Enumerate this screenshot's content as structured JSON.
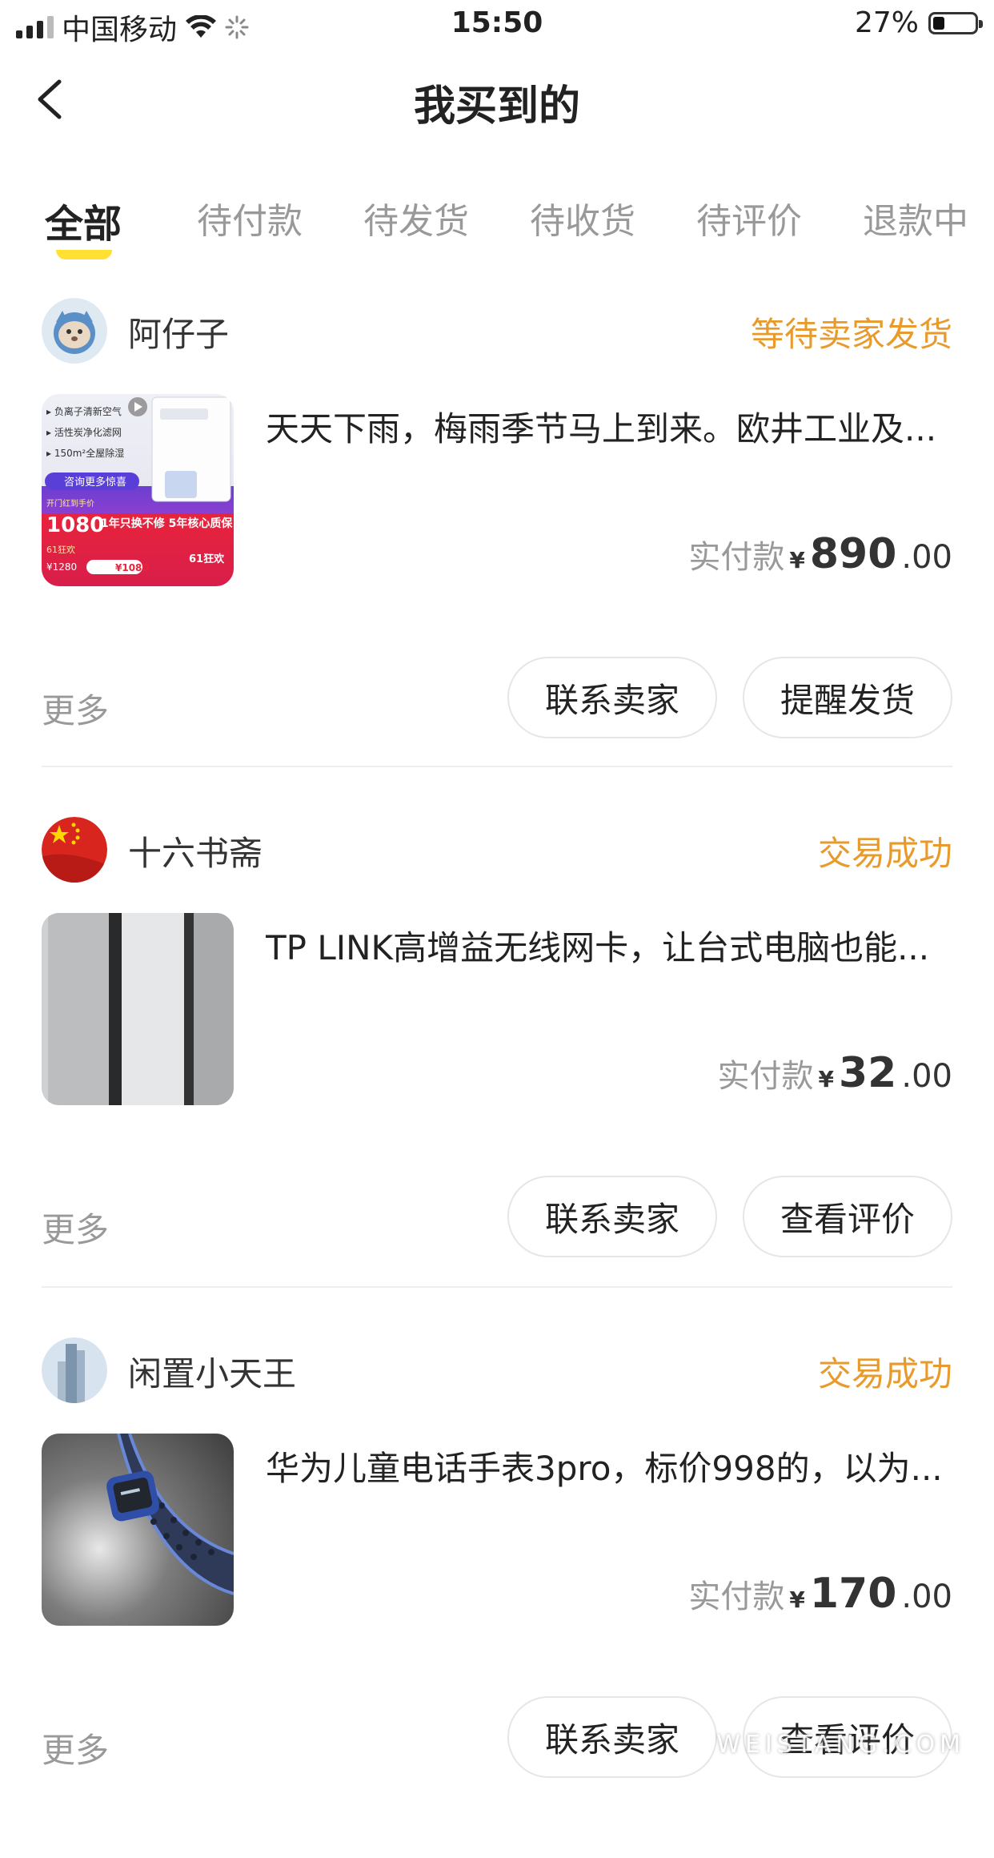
{
  "status_bar": {
    "carrier": "中国移动",
    "time": "15:50",
    "battery": "27%",
    "battery_level": 0.27
  },
  "nav": {
    "title": "我买到的"
  },
  "tabs": [
    {
      "label": "全部",
      "active": true
    },
    {
      "label": "待付款",
      "active": false
    },
    {
      "label": "待发货",
      "active": false
    },
    {
      "label": "待收货",
      "active": false
    },
    {
      "label": "待评价",
      "active": false
    },
    {
      "label": "退款中",
      "active": false
    }
  ],
  "colors": {
    "accent": "#ffe033",
    "status": "#e89a2c"
  },
  "orders": [
    {
      "seller": "阿仔子",
      "status": "等待卖家发货",
      "title": "天天下雨，梅雨季节马上到来。欧井工业及...",
      "price_label": "实付款",
      "currency": "¥",
      "price_int": "890",
      "price_dec": ".00",
      "more": "更多",
      "btn1": "联系卖家",
      "btn2": "提醒发货",
      "thumb": {
        "lines": [
          "负离子清新空气",
          "活性炭净化滤网",
          "150m²全屋除湿"
        ],
        "promo": "咨询更多惊喜",
        "pre_label": "开门红到手价",
        "price": "1080",
        "guarantee": "1年只换不修 5年核心质保",
        "event": "61狂欢",
        "old_price": "1280",
        "new_price": "1080",
        "event2": "61狂欢"
      }
    },
    {
      "seller": "十六书斋",
      "status": "交易成功",
      "title": "TP LINK高增益无线网卡，让台式电脑也能...",
      "price_label": "实付款",
      "currency": "¥",
      "price_int": "32",
      "price_dec": ".00",
      "more": "更多",
      "btn1": "联系卖家",
      "btn2": "查看评价"
    },
    {
      "seller": "闲置小天王",
      "status": "交易成功",
      "title": "华为儿童电话手表3pro，标价998的，以为...",
      "price_label": "实付款",
      "currency": "¥",
      "price_int": "170",
      "price_dec": ".00",
      "more": "更多",
      "btn1": "联系卖家",
      "btn2": "查看评价"
    }
  ],
  "watermark": "WEISTANG.COM"
}
